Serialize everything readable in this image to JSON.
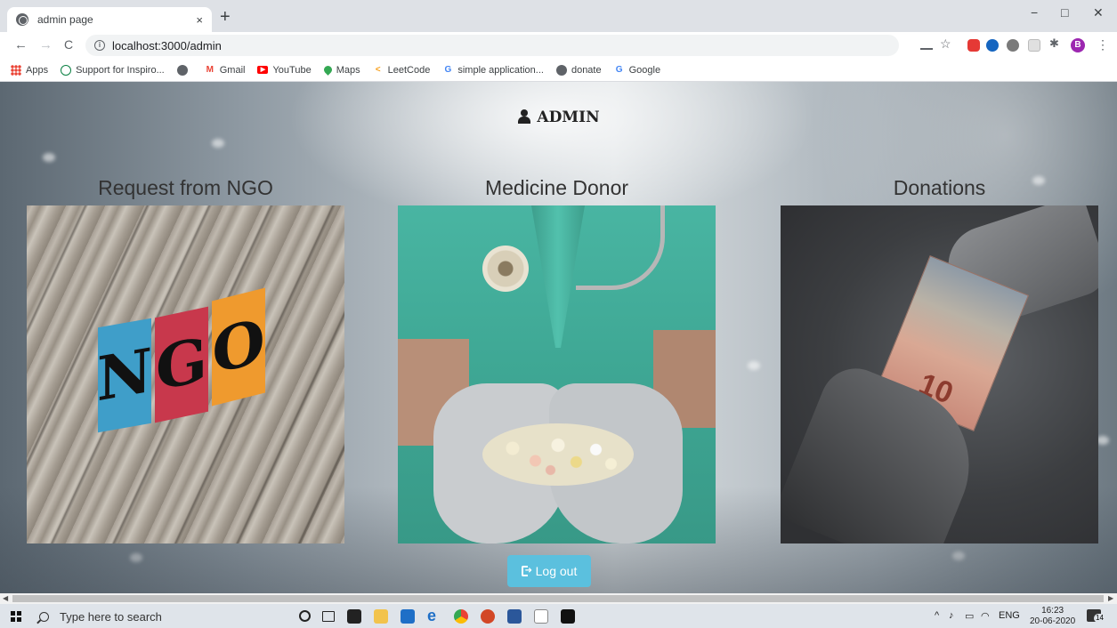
{
  "browser": {
    "tab_title": "admin page",
    "tab_close": "×",
    "new_tab": "+",
    "url": "localhost:3000/admin",
    "nav": {
      "back": "←",
      "forward": "→",
      "reload": "C"
    },
    "window": {
      "minimize": "−",
      "maximize": "□",
      "close": "✕"
    },
    "profile_initial": "B",
    "menu": "⋮",
    "bookmarks": [
      {
        "label": "Apps",
        "icon": "apps-grid-icon",
        "color": "#ea4335"
      },
      {
        "label": "Support for Inspiro...",
        "icon": "support-icon",
        "color": "#0b8043"
      },
      {
        "label": "",
        "icon": "globe-icon",
        "color": "#5f6368"
      },
      {
        "label": "Gmail",
        "icon": "gmail-icon",
        "color": "#ea4335"
      },
      {
        "label": "YouTube",
        "icon": "youtube-icon",
        "color": "#ff0000"
      },
      {
        "label": "Maps",
        "icon": "maps-pin-icon",
        "color": "#34a853"
      },
      {
        "label": "LeetCode",
        "icon": "leetcode-icon",
        "color": "#f89f1b"
      },
      {
        "label": "simple application...",
        "icon": "google-icon",
        "color": "#4285f4"
      },
      {
        "label": "donate",
        "icon": "globe-icon",
        "color": "#5f6368"
      },
      {
        "label": "Google",
        "icon": "google-icon",
        "color": "#4285f4"
      }
    ]
  },
  "page": {
    "heading": "ADMIN",
    "cards": [
      {
        "title": "Request from NGO",
        "image": "ngo-blocks-photo",
        "letters": [
          "N",
          "G",
          "O"
        ]
      },
      {
        "title": "Medicine Donor",
        "image": "medicine-hands-photo"
      },
      {
        "title": "Donations",
        "image": "money-handover-photo",
        "note": "10"
      }
    ],
    "logout_label": "Log out"
  },
  "taskbar": {
    "search_placeholder": "Type here to search",
    "tray_lang": "ENG",
    "time": "16:23",
    "date": "20-06-2020",
    "notification_count": "14",
    "tray_chevron": "^"
  }
}
